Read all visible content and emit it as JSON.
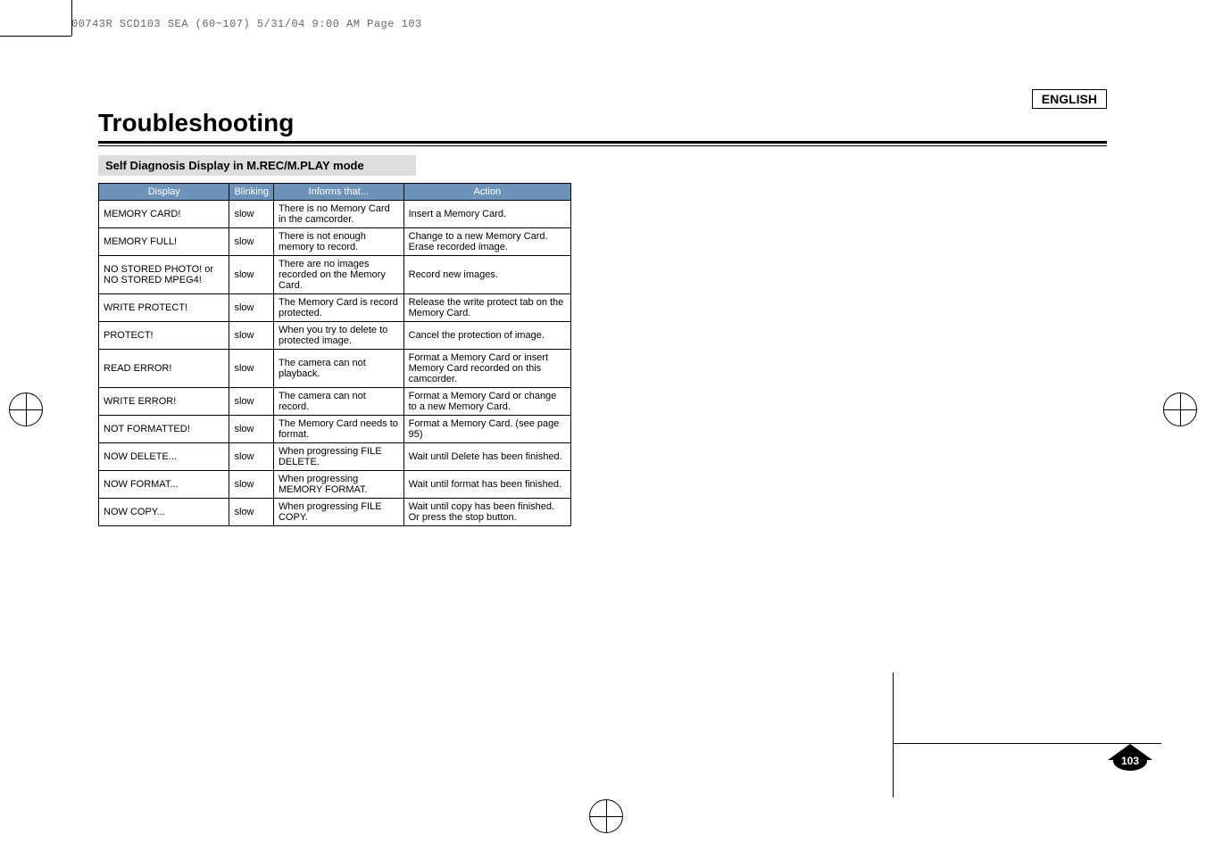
{
  "header_slug": "00743R SCD103 SEA (60~107)  5/31/04 9:00 AM  Page 103",
  "language_label": "ENGLISH",
  "page_title": "Troubleshooting",
  "section_title": "Self Diagnosis Display in M.REC/M.PLAY mode",
  "columns": {
    "display": "Display",
    "blinking": "Blinking",
    "informs": "Informs that...",
    "action": "Action"
  },
  "rows": [
    {
      "display": "MEMORY CARD!",
      "blinking": "slow",
      "informs": "There is no Memory Card in the camcorder.",
      "action": "Insert a Memory Card."
    },
    {
      "display": "MEMORY FULL!",
      "blinking": "slow",
      "informs": "There is not enough memory to record.",
      "action": "Change to a new Memory Card. Erase recorded image."
    },
    {
      "display": "NO STORED PHOTO! or NO STORED MPEG4!",
      "blinking": "slow",
      "informs": "There are no images recorded on the Memory Card.",
      "action": "Record new images."
    },
    {
      "display": "WRITE PROTECT!",
      "blinking": "slow",
      "informs": "The Memory Card is record protected.",
      "action": "Release the write protect tab on the Memory Card."
    },
    {
      "display": "PROTECT!",
      "blinking": "slow",
      "informs": "When you try to delete to protected image.",
      "action": "Cancel the protection of image."
    },
    {
      "display": "READ ERROR!",
      "blinking": "slow",
      "informs": "The camera can not playback.",
      "action": "Format a Memory Card or insert Memory Card recorded on this camcorder."
    },
    {
      "display": "WRITE ERROR!",
      "blinking": "slow",
      "informs": "The camera can not record.",
      "action": "Format a Memory Card or change to a new Memory Card."
    },
    {
      "display": "NOT FORMATTED!",
      "blinking": "slow",
      "informs": "The Memory Card needs to format.",
      "action": "Format a Memory Card. (see page 95)"
    },
    {
      "display": "NOW DELETE...",
      "blinking": "slow",
      "informs": "When progressing FILE DELETE.",
      "action": "Wait until Delete has been finished."
    },
    {
      "display": "NOW FORMAT...",
      "blinking": "slow",
      "informs": "When progressing MEMORY FORMAT.",
      "action": "Wait until format has been finished."
    },
    {
      "display": "NOW COPY...",
      "blinking": "slow",
      "informs": "When progressing FILE COPY.",
      "action": "Wait until copy has been finished. Or press the stop button."
    }
  ],
  "page_number": "103"
}
